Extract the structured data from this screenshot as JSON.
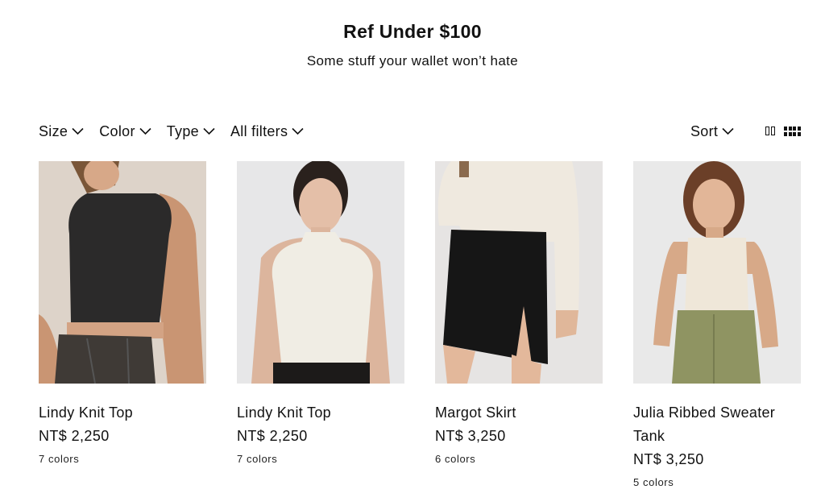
{
  "header": {
    "title": "Ref Under $100",
    "subtitle": "Some stuff your wallet won’t hate"
  },
  "filters": {
    "size": "Size",
    "color": "Color",
    "type": "Type",
    "all": "All filters",
    "sort": "Sort"
  },
  "products": [
    {
      "name": "Lindy Knit Top",
      "price": "NT$ 2,250",
      "colors": "7 colors"
    },
    {
      "name": "Lindy Knit Top",
      "price": "NT$ 2,250",
      "colors": "7 colors"
    },
    {
      "name": "Margot Skirt",
      "price": "NT$ 3,250",
      "colors": "6 colors"
    },
    {
      "name": "Julia Ribbed Sweater Tank",
      "price": "NT$ 3,250",
      "colors": "5 colors"
    }
  ],
  "icons": {
    "chevron": "chevron-down-icon",
    "grid2": "grid-2-icon",
    "grid4": "grid-4-icon"
  }
}
